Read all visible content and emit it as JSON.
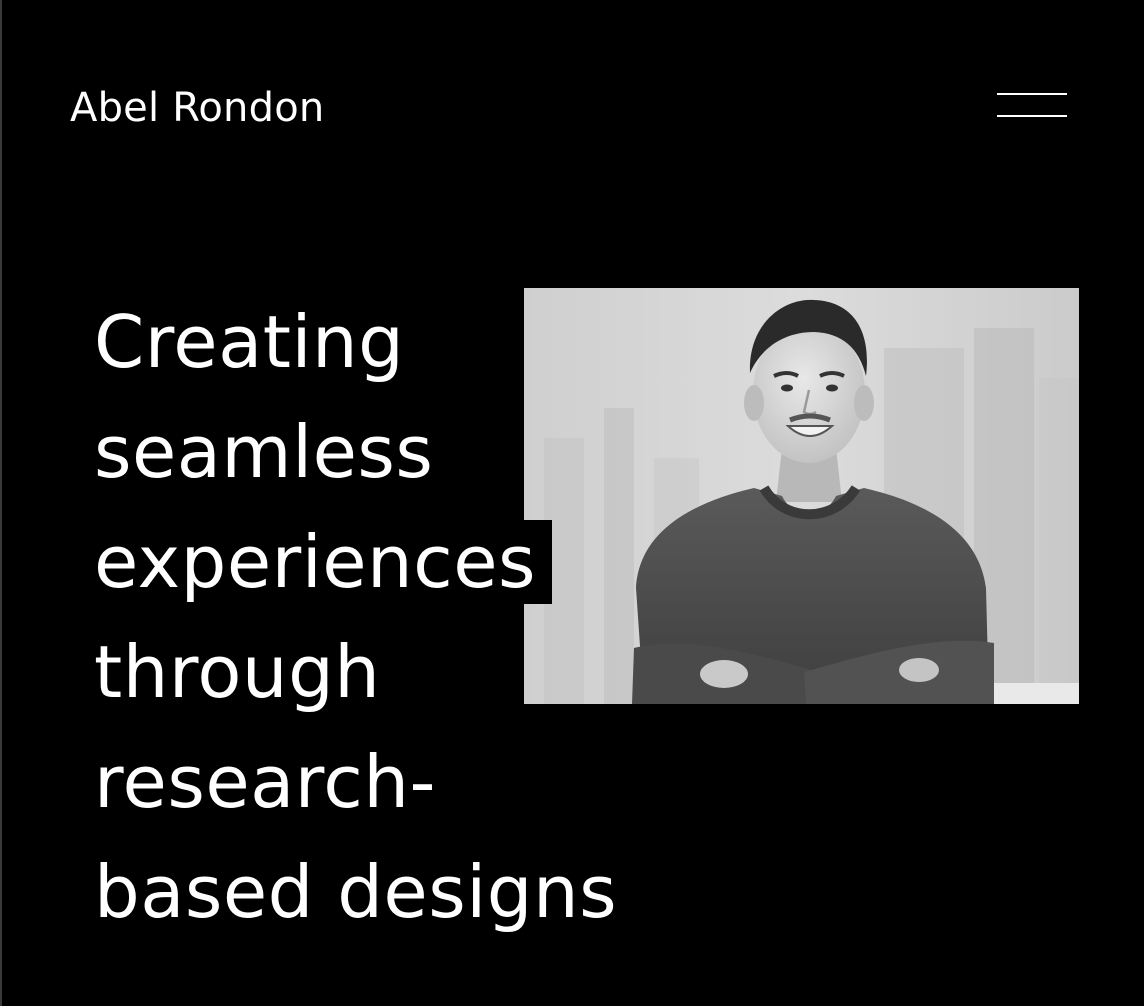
{
  "header": {
    "site_name": "Abel Rondon",
    "menu_icon": "hamburger-menu-icon"
  },
  "hero": {
    "headline_lines": [
      "Creating",
      "seamless",
      "experiences",
      "through",
      "research-",
      "based designs"
    ],
    "photo_icon": "portrait-photo"
  },
  "colors": {
    "background": "#000000",
    "text": "#ffffff"
  }
}
